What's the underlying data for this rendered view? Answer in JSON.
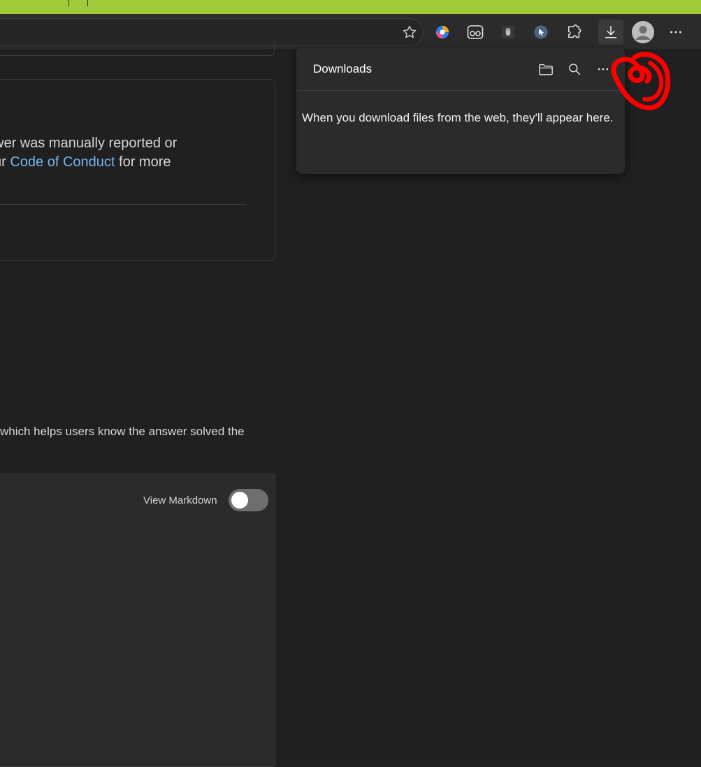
{
  "browser": {
    "toolbar_icons": [
      "favorites-star-icon",
      "copilot-icon",
      "reading-glasses-icon",
      "mouse-extension-icon",
      "cursor-extension-icon",
      "extensions-puzzle-icon",
      "downloads-icon",
      "profile-avatar-icon",
      "more-options-icon"
    ],
    "accent_color": "#9fcb3b"
  },
  "downloads_panel": {
    "title": "Downloads",
    "empty_message": "When you download files from the web, they'll appear here.",
    "icons": [
      "open-folder-icon",
      "search-icon",
      "more-icon"
    ]
  },
  "page": {
    "card_line1": "wer was manually reported or",
    "card_line2_prefix": "ur ",
    "card_link": "Code of Conduct",
    "card_line2_suffix": " for more",
    "helper_text": "which helps users know the answer solved the",
    "view_markdown_label": "View Markdown",
    "view_markdown_on": false
  },
  "annotation_color": "#ff0000"
}
